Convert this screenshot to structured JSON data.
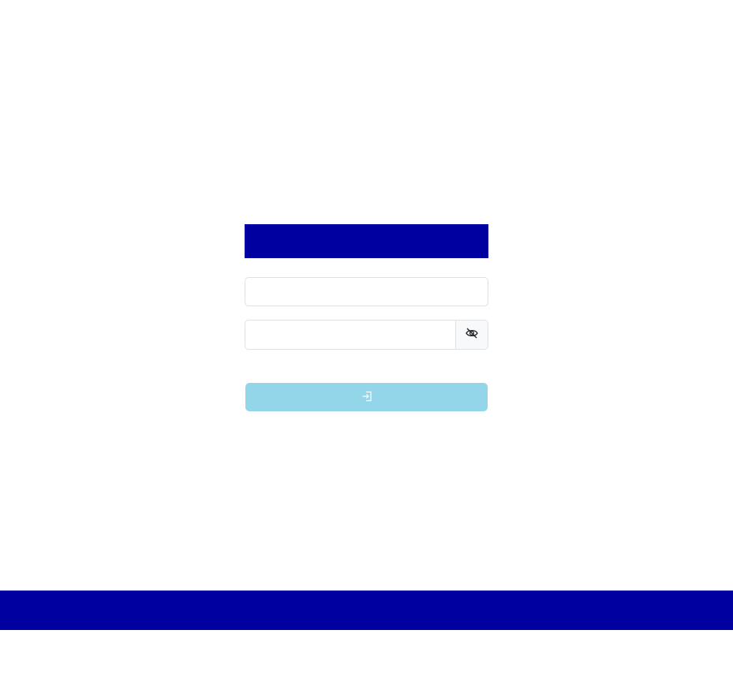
{
  "login": {
    "username_value": "",
    "password_value": "",
    "toggle_icon": "eye-slash-icon",
    "submit_icon": "sign-in-icon"
  },
  "colors": {
    "brand": "#0000a0",
    "button_disabled": "#93d6ea",
    "border": "#dee2e6",
    "addon_bg": "#f8f9fa"
  }
}
